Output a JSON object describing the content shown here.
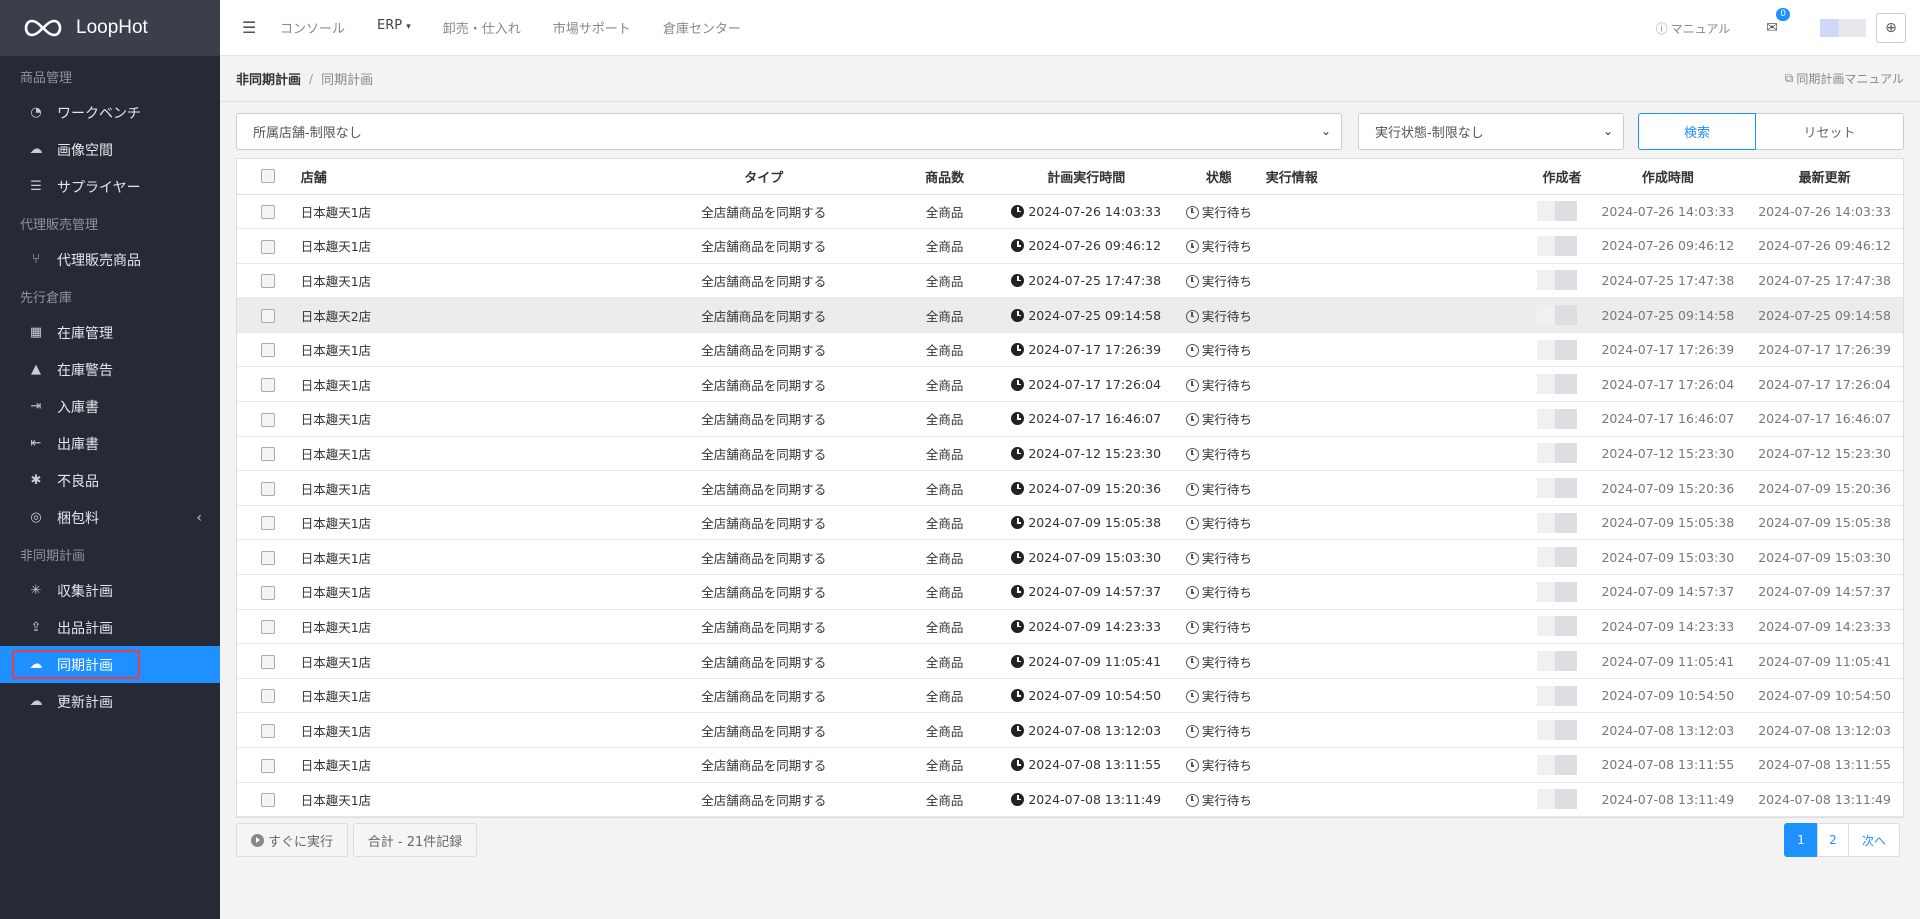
{
  "app": {
    "name": "LoopHot"
  },
  "sidebar": {
    "sections": [
      {
        "title": "商品管理",
        "items": [
          {
            "label": "ワークベンチ",
            "icon": "dashboard-icon"
          },
          {
            "label": "画像空間",
            "icon": "cloud-icon"
          },
          {
            "label": "サプライヤー",
            "icon": "list-icon"
          }
        ]
      },
      {
        "title": "代理販売管理",
        "items": [
          {
            "label": "代理販売商品",
            "icon": "branch-icon"
          }
        ]
      },
      {
        "title": "先行倉庫",
        "items": [
          {
            "label": "在庫管理",
            "icon": "boxes-icon"
          },
          {
            "label": "在庫警告",
            "icon": "warning-icon"
          },
          {
            "label": "入庫書",
            "icon": "sign-in-icon"
          },
          {
            "label": "出庫書",
            "icon": "sign-out-icon"
          },
          {
            "label": "不良品",
            "icon": "bug-icon"
          },
          {
            "label": "梱包料",
            "icon": "package-icon"
          }
        ]
      },
      {
        "title": "非同期計画",
        "items": [
          {
            "label": "収集計画",
            "icon": "spider-icon"
          },
          {
            "label": "出品計画",
            "icon": "upload-icon"
          },
          {
            "label": "同期計画",
            "icon": "cloud-upload-icon"
          },
          {
            "label": "更新計画",
            "icon": "cloud-refresh-icon"
          }
        ]
      }
    ]
  },
  "topbar": {
    "nav": [
      "コンソール",
      "ERP",
      "卸売・仕入れ",
      "市場サポート",
      "倉庫センター"
    ],
    "manual_label": "マニュアル",
    "mail_badge": "0"
  },
  "breadcrumb": {
    "parent": "非同期計画",
    "current": "同期計画",
    "manual_link": "同期計画マニュアル"
  },
  "filters": {
    "store": "所属店舗-制限なし",
    "status": "実行状態-制限なし",
    "search_label": "検索",
    "reset_label": "リセット"
  },
  "table": {
    "columns": [
      "店舗",
      "タイプ",
      "商品数",
      "計画実行時間",
      "状態",
      "実行情報",
      "作成者",
      "作成時間",
      "最新更新"
    ],
    "rows": [
      {
        "store": "日本趣天1店",
        "type": "全店舗商品を同期する",
        "count": "全商品",
        "exec": "2024-07-26 14:03:33",
        "status": "実行待ち",
        "created": "2024-07-26 14:03:33",
        "updated": "2024-07-26 14:03:33"
      },
      {
        "store": "日本趣天1店",
        "type": "全店舗商品を同期する",
        "count": "全商品",
        "exec": "2024-07-26 09:46:12",
        "status": "実行待ち",
        "created": "2024-07-26 09:46:12",
        "updated": "2024-07-26 09:46:12"
      },
      {
        "store": "日本趣天1店",
        "type": "全店舗商品を同期する",
        "count": "全商品",
        "exec": "2024-07-25 17:47:38",
        "status": "実行待ち",
        "created": "2024-07-25 17:47:38",
        "updated": "2024-07-25 17:47:38"
      },
      {
        "store": "日本趣天2店",
        "type": "全店舗商品を同期する",
        "count": "全商品",
        "exec": "2024-07-25 09:14:58",
        "status": "実行待ち",
        "created": "2024-07-25 09:14:58",
        "updated": "2024-07-25 09:14:58"
      },
      {
        "store": "日本趣天1店",
        "type": "全店舗商品を同期する",
        "count": "全商品",
        "exec": "2024-07-17 17:26:39",
        "status": "実行待ち",
        "created": "2024-07-17 17:26:39",
        "updated": "2024-07-17 17:26:39"
      },
      {
        "store": "日本趣天1店",
        "type": "全店舗商品を同期する",
        "count": "全商品",
        "exec": "2024-07-17 17:26:04",
        "status": "実行待ち",
        "created": "2024-07-17 17:26:04",
        "updated": "2024-07-17 17:26:04"
      },
      {
        "store": "日本趣天1店",
        "type": "全店舗商品を同期する",
        "count": "全商品",
        "exec": "2024-07-17 16:46:07",
        "status": "実行待ち",
        "created": "2024-07-17 16:46:07",
        "updated": "2024-07-17 16:46:07"
      },
      {
        "store": "日本趣天1店",
        "type": "全店舗商品を同期する",
        "count": "全商品",
        "exec": "2024-07-12 15:23:30",
        "status": "実行待ち",
        "created": "2024-07-12 15:23:30",
        "updated": "2024-07-12 15:23:30"
      },
      {
        "store": "日本趣天1店",
        "type": "全店舗商品を同期する",
        "count": "全商品",
        "exec": "2024-07-09 15:20:36",
        "status": "実行待ち",
        "created": "2024-07-09 15:20:36",
        "updated": "2024-07-09 15:20:36"
      },
      {
        "store": "日本趣天1店",
        "type": "全店舗商品を同期する",
        "count": "全商品",
        "exec": "2024-07-09 15:05:38",
        "status": "実行待ち",
        "created": "2024-07-09 15:05:38",
        "updated": "2024-07-09 15:05:38"
      },
      {
        "store": "日本趣天1店",
        "type": "全店舗商品を同期する",
        "count": "全商品",
        "exec": "2024-07-09 15:03:30",
        "status": "実行待ち",
        "created": "2024-07-09 15:03:30",
        "updated": "2024-07-09 15:03:30"
      },
      {
        "store": "日本趣天1店",
        "type": "全店舗商品を同期する",
        "count": "全商品",
        "exec": "2024-07-09 14:57:37",
        "status": "実行待ち",
        "created": "2024-07-09 14:57:37",
        "updated": "2024-07-09 14:57:37"
      },
      {
        "store": "日本趣天1店",
        "type": "全店舗商品を同期する",
        "count": "全商品",
        "exec": "2024-07-09 14:23:33",
        "status": "実行待ち",
        "created": "2024-07-09 14:23:33",
        "updated": "2024-07-09 14:23:33"
      },
      {
        "store": "日本趣天1店",
        "type": "全店舗商品を同期する",
        "count": "全商品",
        "exec": "2024-07-09 11:05:41",
        "status": "実行待ち",
        "created": "2024-07-09 11:05:41",
        "updated": "2024-07-09 11:05:41"
      },
      {
        "store": "日本趣天1店",
        "type": "全店舗商品を同期する",
        "count": "全商品",
        "exec": "2024-07-09 10:54:50",
        "status": "実行待ち",
        "created": "2024-07-09 10:54:50",
        "updated": "2024-07-09 10:54:50"
      },
      {
        "store": "日本趣天1店",
        "type": "全店舗商品を同期する",
        "count": "全商品",
        "exec": "2024-07-08 13:12:03",
        "status": "実行待ち",
        "created": "2024-07-08 13:12:03",
        "updated": "2024-07-08 13:12:03"
      },
      {
        "store": "日本趣天1店",
        "type": "全店舗商品を同期する",
        "count": "全商品",
        "exec": "2024-07-08 13:11:55",
        "status": "実行待ち",
        "created": "2024-07-08 13:11:55",
        "updated": "2024-07-08 13:11:55"
      },
      {
        "store": "日本趣天1店",
        "type": "全店舗商品を同期する",
        "count": "全商品",
        "exec": "2024-07-08 13:11:49",
        "status": "実行待ち",
        "created": "2024-07-08 13:11:49",
        "updated": "2024-07-08 13:11:49"
      }
    ]
  },
  "footer": {
    "run_now_label": "すぐに実行",
    "total_label": "合計 - 21件記録",
    "pages": [
      "1",
      "2"
    ],
    "next_label": "次へ"
  },
  "colors": {
    "accent": "#1e90ff",
    "sidebar_bg": "#262a36",
    "highlight": "#e53e4d"
  }
}
